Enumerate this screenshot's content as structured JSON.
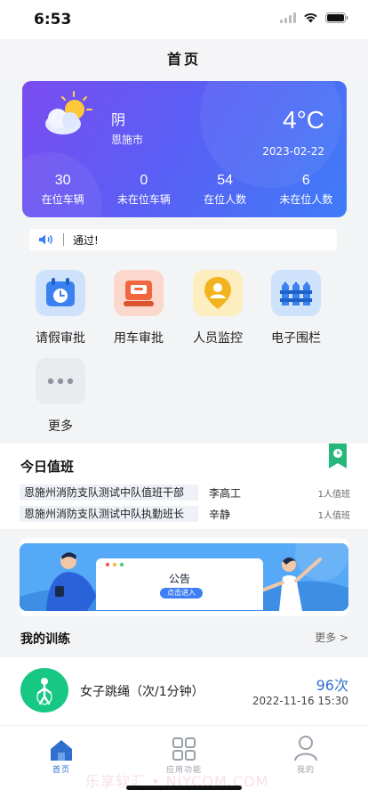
{
  "status": {
    "time": "6:53"
  },
  "nav": {
    "title": "首页"
  },
  "weather": {
    "condition": "阴",
    "city": "恩施市",
    "temperature": "4°C",
    "date": "2023-02-22",
    "stats": [
      {
        "value": "30",
        "label": "在位车辆"
      },
      {
        "value": "0",
        "label": "未在位车辆"
      },
      {
        "value": "54",
        "label": "在位人数"
      },
      {
        "value": "6",
        "label": "未在位人数"
      }
    ]
  },
  "notice": {
    "text": "通过!"
  },
  "apps": [
    {
      "label": "请假审批",
      "icon": "calendar-clock-icon",
      "bg": "#cfe2fb",
      "fg": "#3b82f0"
    },
    {
      "label": "用车审批",
      "icon": "car-stamp-icon",
      "bg": "#fcd7cc",
      "fg": "#f0673f"
    },
    {
      "label": "人员监控",
      "icon": "person-pin-icon",
      "bg": "#fdeec0",
      "fg": "#f3b31f"
    },
    {
      "label": "电子围栏",
      "icon": "fence-icon",
      "bg": "#cfe2fb",
      "fg": "#3b82f0"
    },
    {
      "label": "更多",
      "icon": "more-dots-icon",
      "bg": "#e9ebef",
      "fg": "#8f96a3"
    }
  ],
  "duty": {
    "title": "今日值班",
    "rows": [
      {
        "unit": "恩施州消防支队测试中队值班干部",
        "person": "李高工",
        "count": "1人值班"
      },
      {
        "unit": "恩施州消防支队测试中队执勤班长",
        "person": "辛静",
        "count": "1人值班"
      }
    ]
  },
  "banner": {
    "title": "公告",
    "button": "点击进入"
  },
  "training": {
    "title": "我的训练",
    "more": "更多 >",
    "item": {
      "name": "女子跳绳（次/1分钟）",
      "value": "96次",
      "time": "2022-11-16 15:30"
    }
  },
  "tabs": [
    {
      "label": "首页",
      "icon": "home-icon",
      "active": true
    },
    {
      "label": "应用功能",
      "icon": "grid-icon",
      "active": false
    },
    {
      "label": "我的",
      "icon": "user-icon",
      "active": false
    }
  ],
  "watermark": "乐享软汇 • NJYCOM.COM",
  "colors": {
    "accent": "#2f6fce",
    "weather_start": "#7a4cf0",
    "weather_end": "#3f7cf8"
  }
}
